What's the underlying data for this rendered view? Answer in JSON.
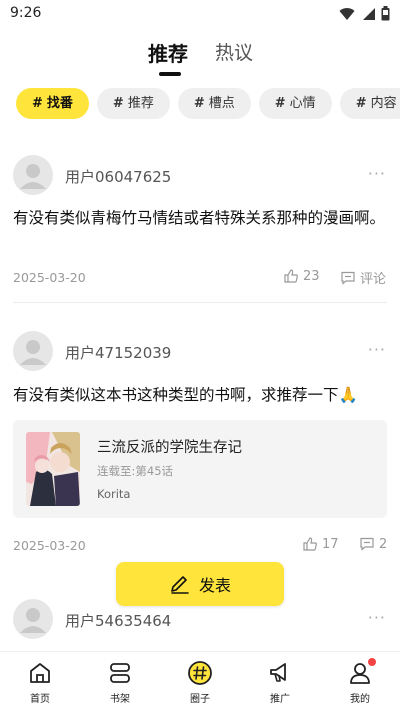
{
  "status_bar": {
    "time": "9:26",
    "icons": [
      "wifi-icon",
      "signal-icon",
      "battery-icon"
    ]
  },
  "top_tabs": [
    {
      "label": "推荐",
      "active": true
    },
    {
      "label": "热议",
      "active": false
    }
  ],
  "chips": [
    {
      "hash": "#",
      "label": "找番",
      "active": true
    },
    {
      "hash": "#",
      "label": "推荐",
      "active": false
    },
    {
      "hash": "#",
      "label": "槽点",
      "active": false
    },
    {
      "hash": "#",
      "label": "心情",
      "active": false
    },
    {
      "hash": "#",
      "label": "内容",
      "active": false
    }
  ],
  "posts": [
    {
      "username": "用户06047625",
      "more": "···",
      "text": "有没有类似青梅竹马情结或者特殊关系那种的漫画啊。",
      "date": "2025-03-20",
      "likes": "23",
      "comment_label": "评论"
    },
    {
      "username": "用户47152039",
      "more": "···",
      "text": "有没有类似这本书这种类型的书啊，求推荐一下🙏",
      "book": {
        "title": "三流反派的学院生存记",
        "progress": "连载至:第45话",
        "author": "Korita"
      },
      "date": "2025-03-20",
      "likes": "17",
      "comments": "2"
    },
    {
      "username": "用户54635464",
      "more": "···"
    }
  ],
  "publish_button": {
    "label": "发表",
    "icon": "pen-icon"
  },
  "bottom_nav": [
    {
      "label": "首页",
      "icon": "home-icon"
    },
    {
      "label": "书架",
      "icon": "bookshelf-icon"
    },
    {
      "label": "圈子",
      "icon": "circle-hash-icon",
      "active": true
    },
    {
      "label": "推广",
      "icon": "megaphone-icon"
    },
    {
      "label": "我的",
      "icon": "user-icon",
      "badge": true
    }
  ],
  "colors": {
    "accent": "#ffe53b",
    "badge": "#f24444",
    "muted_text": "#999999"
  }
}
